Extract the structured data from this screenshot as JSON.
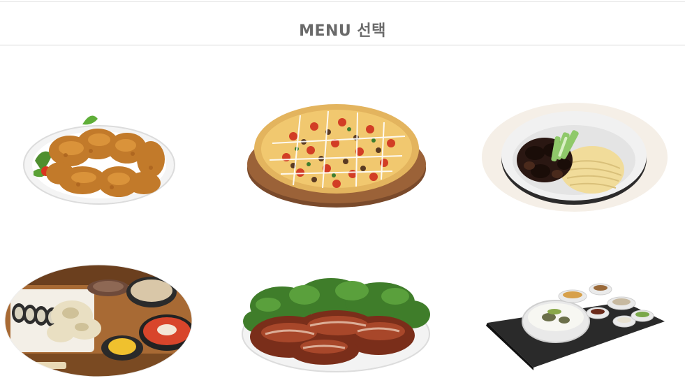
{
  "header": {
    "title": "MENU 선택"
  },
  "menu": {
    "items": [
      {
        "icon": "fried-chicken-image"
      },
      {
        "icon": "pizza-image"
      },
      {
        "icon": "jajangmyeon-image"
      },
      {
        "icon": "japanese-set-image"
      },
      {
        "icon": "jokbal-image"
      },
      {
        "icon": "korean-set-meal-image"
      }
    ]
  },
  "colors": {
    "title": "#6a6a6a",
    "divider": "#d9d9d9",
    "background": "#ffffff"
  }
}
